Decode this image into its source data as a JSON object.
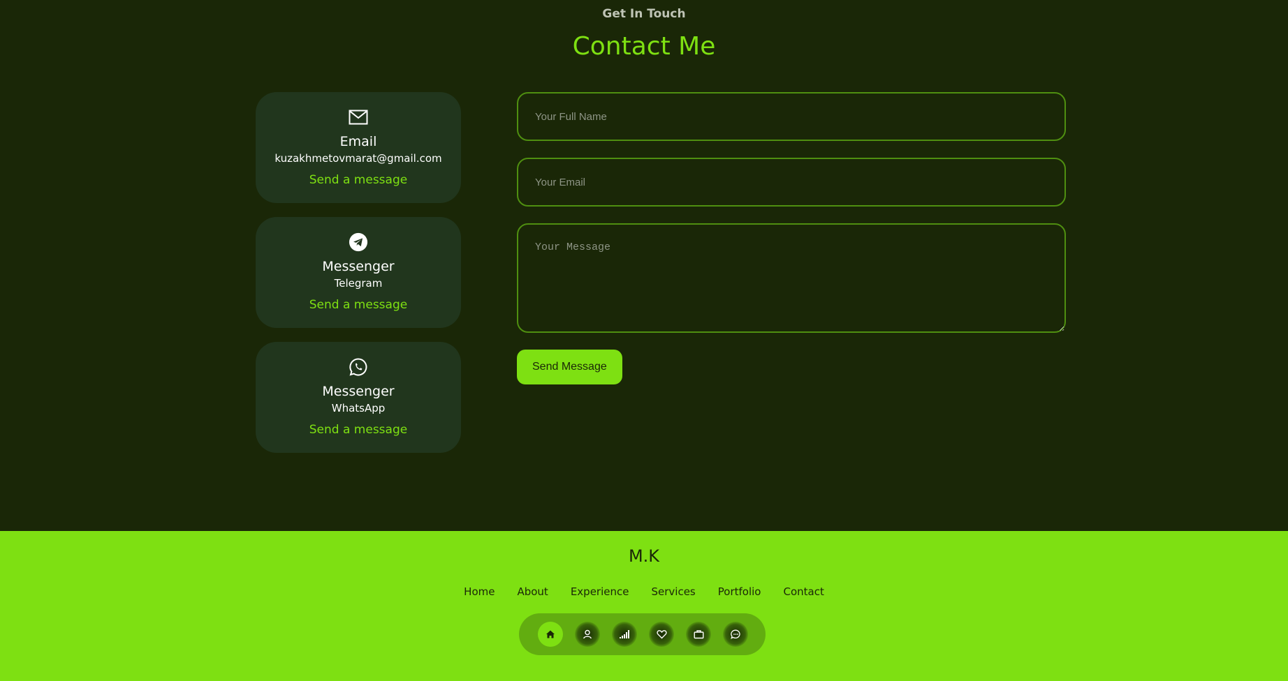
{
  "contact": {
    "subtitle": "Get In Touch",
    "heading": "Contact Me",
    "cards": [
      {
        "icon": "envelope-icon",
        "title": "Email",
        "value": "kuzakhmetovmarat@gmail.com",
        "link": "Send a message"
      },
      {
        "icon": "telegram-icon",
        "title": "Messenger",
        "value": "Telegram",
        "link": "Send a message"
      },
      {
        "icon": "whatsapp-icon",
        "title": "Messenger",
        "value": "WhatsApp",
        "link": "Send a message"
      }
    ],
    "form": {
      "name_placeholder": "Your Full Name",
      "email_placeholder": "Your Email",
      "message_placeholder": "Your Message",
      "send_label": "Send Message"
    }
  },
  "footer": {
    "logo": "M.K",
    "nav": [
      "Home",
      "About",
      "Experience",
      "Services",
      "Portfolio",
      "Contact"
    ],
    "dock": [
      {
        "icon": "home-icon",
        "active": true
      },
      {
        "icon": "user-icon",
        "active": false
      },
      {
        "icon": "signal-icon",
        "active": false
      },
      {
        "icon": "heart-icon",
        "active": false
      },
      {
        "icon": "briefcase-icon",
        "active": false
      },
      {
        "icon": "chat-icon",
        "active": false
      }
    ]
  },
  "colors": {
    "background": "#1a2707",
    "card": "#21361d",
    "accent": "#7ee012",
    "field_border": "#4f8f10",
    "dock": "#62ad10"
  }
}
